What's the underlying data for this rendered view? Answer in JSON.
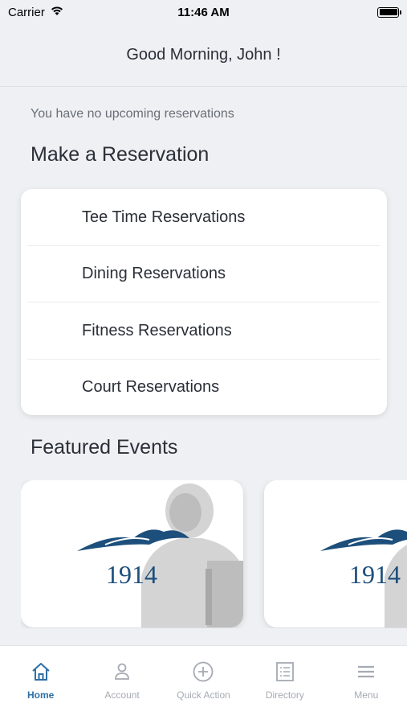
{
  "status_bar": {
    "carrier": "Carrier",
    "time": "11:46 AM"
  },
  "header": {
    "greeting": "Good Morning, John !"
  },
  "reservations": {
    "empty_message": "You have no upcoming reservations",
    "section_title": "Make a Reservation",
    "items": [
      {
        "label": "Tee Time Reservations"
      },
      {
        "label": "Dining Reservations"
      },
      {
        "label": "Fitness Reservations"
      },
      {
        "label": "Court Reservations"
      }
    ]
  },
  "events": {
    "section_title": "Featured Events",
    "cards": [
      {
        "logo_text": "1914"
      },
      {
        "logo_text": "1914"
      }
    ]
  },
  "tab_bar": {
    "tabs": [
      {
        "label": "Home",
        "icon": "home-icon",
        "active": true
      },
      {
        "label": "Account",
        "icon": "person-icon",
        "active": false
      },
      {
        "label": "Quick Action",
        "icon": "plus-circle-icon",
        "active": false
      },
      {
        "label": "Directory",
        "icon": "list-doc-icon",
        "active": false
      },
      {
        "label": "Menu",
        "icon": "hamburger-icon",
        "active": false
      }
    ]
  },
  "colors": {
    "accent": "#2e6fa5",
    "logo_blue": "#1d4f7c",
    "inactive": "#a6aab2",
    "background": "#eef0f3"
  }
}
